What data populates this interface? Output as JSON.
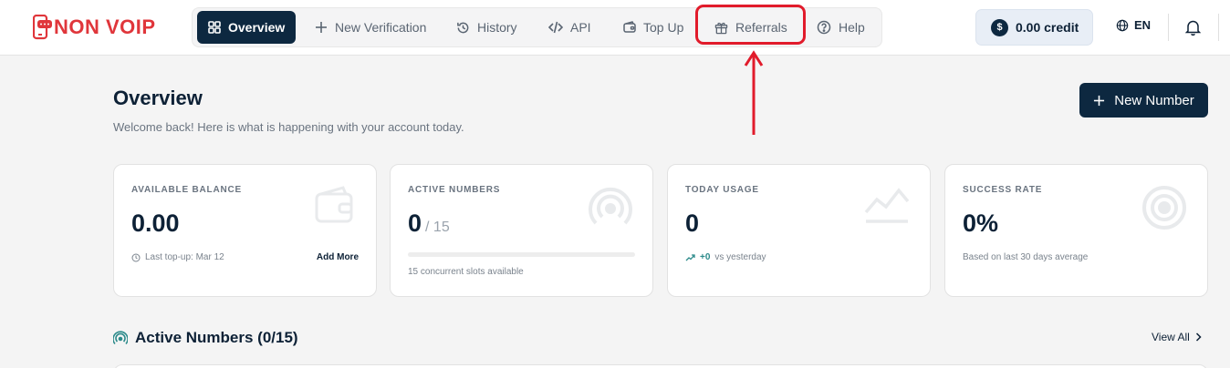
{
  "brand": {
    "name": "NON VOIP",
    "colors": {
      "accent": "#e0363b",
      "primary": "#0d2840",
      "highlight": "#e11b2b"
    }
  },
  "nav": {
    "items": [
      {
        "label": "Overview",
        "icon": "grid-icon",
        "active": true
      },
      {
        "label": "New Verification",
        "icon": "plus-icon",
        "active": false
      },
      {
        "label": "History",
        "icon": "history-icon",
        "active": false
      },
      {
        "label": "API",
        "icon": "code-icon",
        "active": false
      },
      {
        "label": "Top Up",
        "icon": "wallet-icon",
        "active": false
      },
      {
        "label": "Referrals",
        "icon": "gift-icon",
        "active": false
      },
      {
        "label": "Help",
        "icon": "help-icon",
        "active": false
      }
    ]
  },
  "header": {
    "credit": {
      "symbol": "$",
      "label": "0.00 credit"
    },
    "language": "EN"
  },
  "page": {
    "title": "Overview",
    "subtitle": "Welcome back! Here is what is happening with your account today.",
    "new_number_label": "New Number"
  },
  "cards": {
    "balance": {
      "label": "AVAILABLE BALANCE",
      "value": "0.00",
      "footer": "Last top-up: Mar 12",
      "link": "Add More",
      "icon": "wallet-icon"
    },
    "active_numbers": {
      "label": "ACTIVE NUMBERS",
      "value": "0",
      "suffix": "/ 15",
      "progress_fraction": 0,
      "footer": "15 concurrent slots available",
      "icon": "signal-icon"
    },
    "today_usage": {
      "label": "TODAY USAGE",
      "value": "0",
      "delta": "+0",
      "footer": "vs yesterday",
      "icon": "chart-line-icon"
    },
    "success_rate": {
      "label": "SUCCESS RATE",
      "value": "0%",
      "footer": "Based on last 30 days average",
      "icon": "target-icon"
    }
  },
  "active_numbers_section": {
    "title": "Active Numbers (0/15)",
    "view_all": "View All"
  }
}
